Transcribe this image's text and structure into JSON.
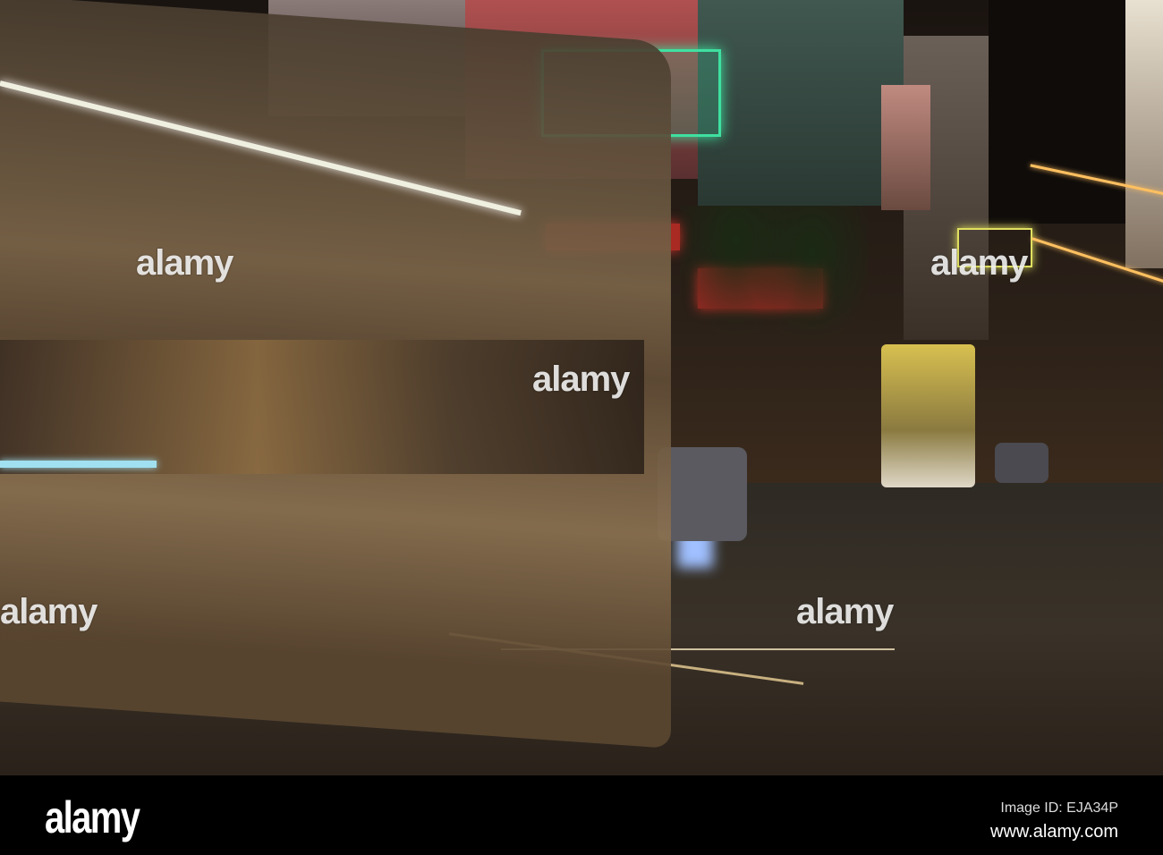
{
  "watermarks": [
    "alamy",
    "alamy",
    "alamy",
    "alamy",
    "alamy",
    "alamy"
  ],
  "footer": {
    "logo": "alamy",
    "image_id": "Image ID: EJA34P",
    "url": "www.alamy.com"
  },
  "colors": {
    "bus": "#7a6448",
    "neon_green": "#3fe0a0",
    "neon_red": "#e0302a",
    "street_light": "#ffc060"
  }
}
